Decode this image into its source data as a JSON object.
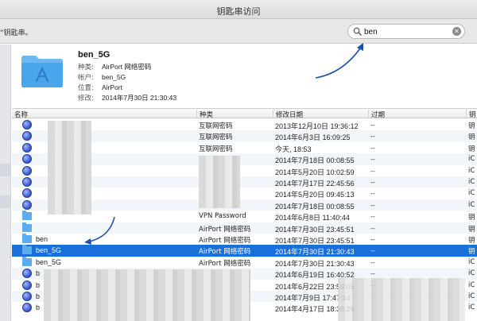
{
  "window": {
    "title": "钥匙串访问"
  },
  "toolbar": {
    "hint": "“钥匙串。"
  },
  "search": {
    "value": "ben",
    "clear_icon": "clear-icon"
  },
  "detail": {
    "name": "ben_5G",
    "fields": [
      {
        "key": "种类:",
        "value": "AirPort 网络密码"
      },
      {
        "key": "帐户:",
        "value": "ben_5G"
      },
      {
        "key": "位置:",
        "value": "AirPort"
      },
      {
        "key": "修改:",
        "value": "2014年7月30日 21:30:43"
      }
    ]
  },
  "table": {
    "columns": [
      "名称",
      "种类",
      "修改日期",
      "过期",
      "钥"
    ],
    "rows": [
      {
        "icon": "globe-icon",
        "name": "",
        "kind": "互联网密码",
        "date": "2013年12月10日 19:36:12",
        "expires": "--",
        "more": "钥"
      },
      {
        "icon": "globe-icon",
        "name": "",
        "kind": "互联网密码",
        "date": "2014年6月3日 16:09:25",
        "expires": "--",
        "more": "钥"
      },
      {
        "icon": "globe-icon",
        "name": "",
        "kind": "互联网密码",
        "date": "今天, 18:53",
        "expires": "--",
        "more": "钥"
      },
      {
        "icon": "globe-icon",
        "name": "",
        "kind": "",
        "date": "2014年7月18日 00:08:55",
        "expires": "--",
        "more": "iC"
      },
      {
        "icon": "globe-icon",
        "name": "",
        "kind": "",
        "date": "2014年5月20日 10:02:59",
        "expires": "--",
        "more": "iC"
      },
      {
        "icon": "globe-icon",
        "name": "",
        "kind": "",
        "date": "2014年7月17日 22:45:56",
        "expires": "--",
        "more": "iC"
      },
      {
        "icon": "globe-icon",
        "name": "",
        "kind": "",
        "date": "2014年5月20日 09:45:13",
        "expires": "--",
        "more": "iC"
      },
      {
        "icon": "globe-icon",
        "name": "",
        "kind": "",
        "date": "2014年7月18日 00:08:55",
        "expires": "--",
        "more": "iC"
      },
      {
        "icon": "folder-icon",
        "name": "",
        "kind": "VPN Password",
        "date": "2014年6月8日 11:40:44",
        "expires": "--",
        "more": "钥"
      },
      {
        "icon": "folder-icon",
        "name": "",
        "kind": "AirPort 网络密码",
        "date": "2014年7月30日 23:45:51",
        "expires": "--",
        "more": "钥"
      },
      {
        "icon": "folder-icon",
        "name": "ben",
        "kind": "AirPort 网络密码",
        "date": "2014年7月30日 23:45:51",
        "expires": "--",
        "more": "钥"
      },
      {
        "icon": "folder-icon",
        "name": "ben_5G",
        "kind": "AirPort 网络密码",
        "date": "2014年7月30日 21:30:43",
        "expires": "--",
        "more": "钥",
        "selected": true
      },
      {
        "icon": "folder-icon",
        "name": "ben_5G",
        "kind": "AirPort 网络密码",
        "date": "2014年7月30日 21:30:43",
        "expires": "--",
        "more": "iC"
      },
      {
        "icon": "globe-icon",
        "name": "b",
        "kind": "",
        "date": "2014年6月19日 16:40:52",
        "expires": "--",
        "more": "iC"
      },
      {
        "icon": "globe-icon",
        "name": "b",
        "kind": "",
        "date": "2014年6月22日 23:59:05",
        "expires": "--",
        "more": "iC"
      },
      {
        "icon": "globe-icon",
        "name": "b",
        "kind": "",
        "date": "2014年7月9日 17:47:14",
        "expires": "",
        "more": "iC"
      },
      {
        "icon": "globe-icon",
        "name": "b",
        "kind": "",
        "date": "2014年4月17日 18:38:26",
        "expires": "",
        "more": "iC"
      }
    ]
  },
  "colors": {
    "selection": "#1a6fd8",
    "arrow": "#1f4fa8",
    "folder": "#5aaef0"
  }
}
